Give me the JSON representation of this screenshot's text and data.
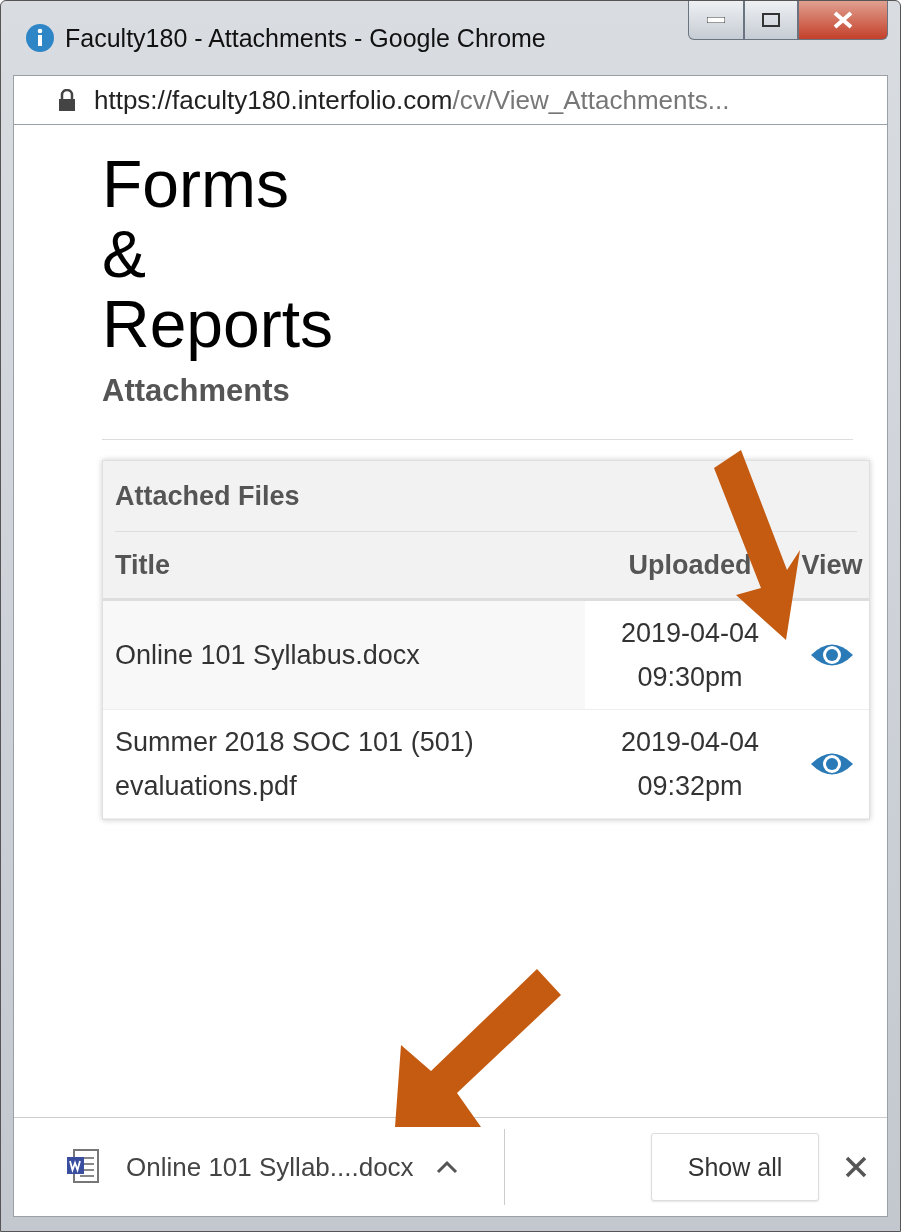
{
  "window": {
    "title": "Faculty180 - Attachments - Google Chrome"
  },
  "address_bar": {
    "host": "https://faculty180.interfolio.com",
    "path": "/cv/View_Attachments..."
  },
  "page": {
    "heading_lines": [
      "Forms",
      "&",
      "Reports"
    ],
    "subheading": "Attachments"
  },
  "panel": {
    "title": "Attached Files",
    "columns": [
      "Title",
      "Uploaded",
      "View"
    ],
    "rows": [
      {
        "title": "Online 101 Syllabus.docx",
        "uploaded": [
          "2019-04-04",
          "09:30pm"
        ]
      },
      {
        "title": "Summer 2018 SOC 101 (501) evaluations.pdf",
        "uploaded": [
          "2019-04-04",
          "09:32pm"
        ]
      }
    ]
  },
  "download_bar": {
    "file": "Online 101 Syllab....docx",
    "button": "Show all"
  }
}
